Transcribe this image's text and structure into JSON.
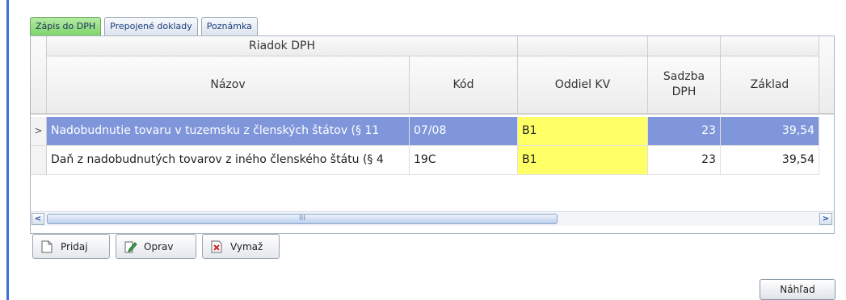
{
  "tabs": [
    {
      "label": "Zápis do DPH",
      "active": true
    },
    {
      "label": "Prepojené doklady",
      "active": false
    },
    {
      "label": "Poznámka",
      "active": false
    }
  ],
  "grid": {
    "band_header": "Riadok DPH",
    "columns": [
      "Názov",
      "Kód",
      "Oddiel KV",
      "Sadzba DPH",
      "Základ"
    ],
    "rows": [
      {
        "nazov": "Nadobudnutie tovaru v tuzemsku z členských štátov (§ 11",
        "kod": "07/08",
        "oddiel": "B1",
        "sadzba": "23",
        "zaklad": "39,54",
        "selected": true
      },
      {
        "nazov": "Daň z nadobudnutých tovarov z iného členského štátu (§ 4",
        "kod": "19C",
        "oddiel": "B1",
        "sadzba": "23",
        "zaklad": "39,54",
        "selected": false
      }
    ],
    "row_indicator": ">",
    "scroll_left": "<",
    "scroll_right": ">",
    "scroll_grip": "III"
  },
  "buttons": {
    "pridaj": "Pridaj",
    "oprav": "Oprav",
    "vymaz": "Vymaž",
    "nahlad": "Náhľad"
  },
  "colors": {
    "active_tab": "#7fd46b",
    "selected_row": "#7f96db",
    "oddiel_highlight": "#ffff66"
  }
}
